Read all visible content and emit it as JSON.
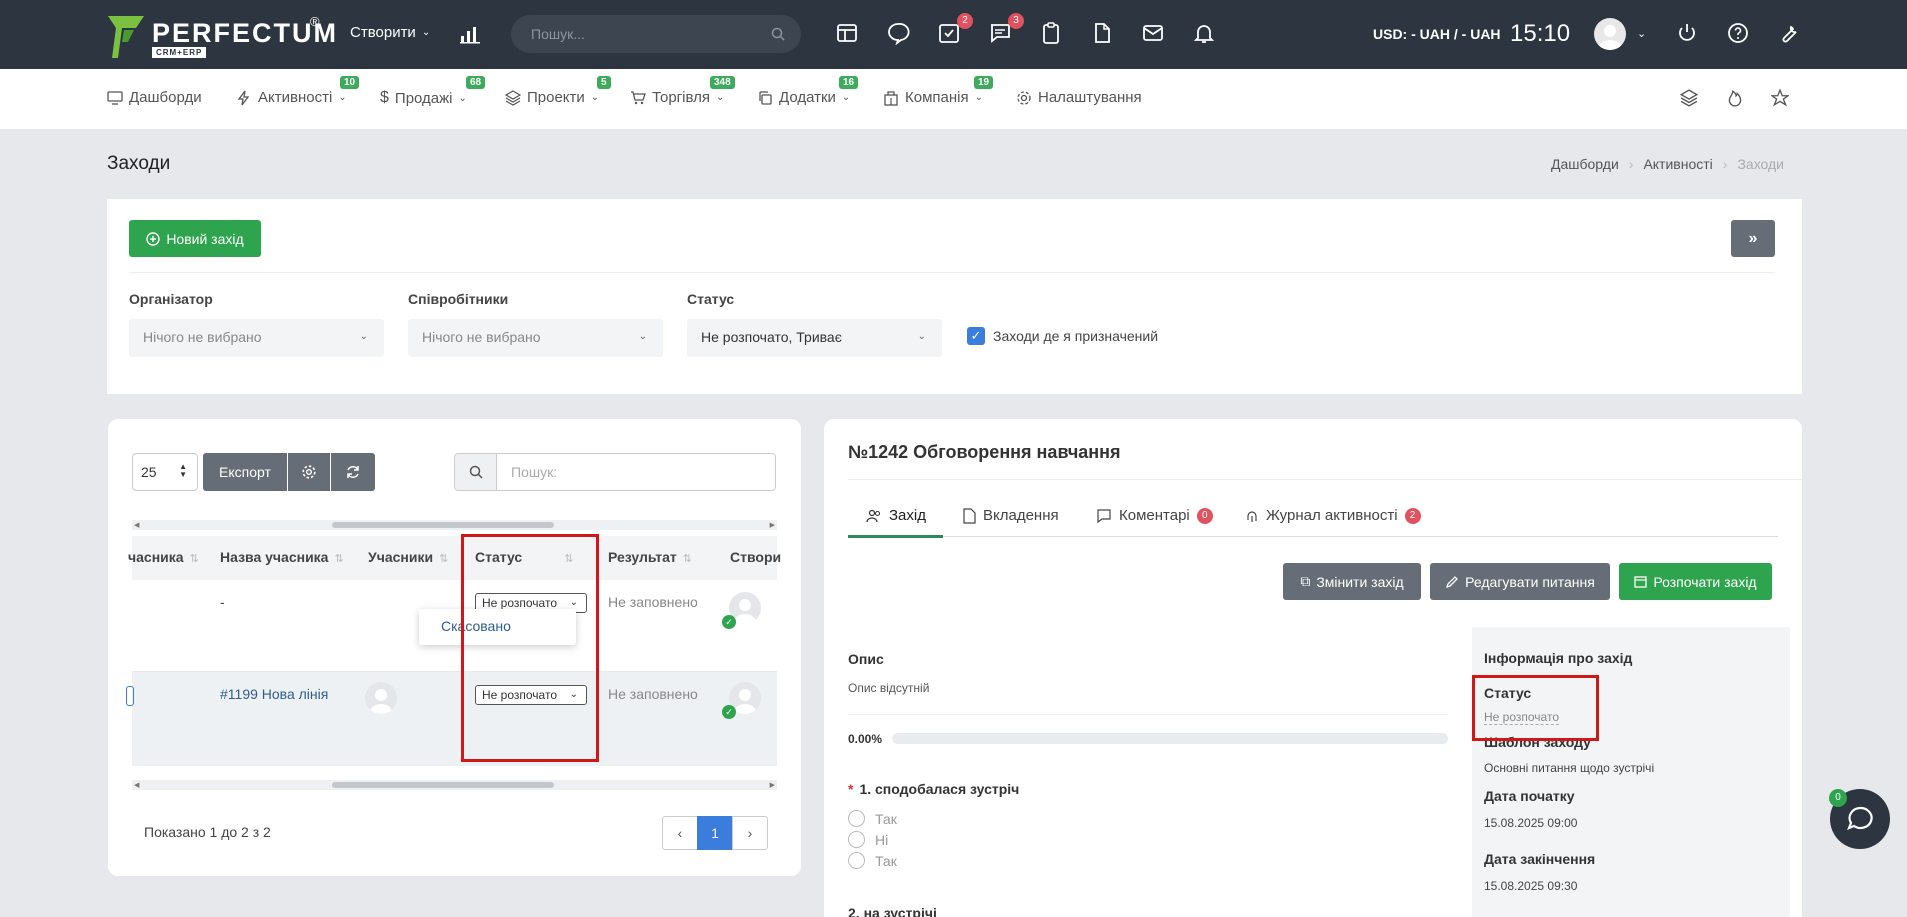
{
  "topbar": {
    "logo": {
      "name": "PERFECTUM",
      "sub": "CRM+ERP",
      "reg": "®"
    },
    "create_label": "Створити",
    "search_placeholder": "Пошук...",
    "tasks_badge": "2",
    "chat_badge": "3",
    "currency": "USD: - UAH / - UAH",
    "time": "15:10"
  },
  "nav": {
    "items": [
      {
        "label": "Дашборди",
        "badge": ""
      },
      {
        "label": "Активності",
        "badge": "10"
      },
      {
        "label": "Продажі",
        "badge": "68"
      },
      {
        "label": "Проекти",
        "badge": "5"
      },
      {
        "label": "Торгівля",
        "badge": "348"
      },
      {
        "label": "Додатки",
        "badge": "16"
      },
      {
        "label": "Компанія",
        "badge": "19"
      },
      {
        "label": "Налаштування",
        "badge": ""
      }
    ]
  },
  "page": {
    "title": "Заходи",
    "breadcrumb": [
      "Дашборди",
      "Активності",
      "Заходи"
    ]
  },
  "filters": {
    "new_button": "Новий захід",
    "expand_button": "»",
    "organizer": {
      "label": "Організатор",
      "value": "Нічого не вибрано"
    },
    "employees": {
      "label": "Співробітники",
      "value": "Нічого не вибрано"
    },
    "status": {
      "label": "Статус",
      "value": "Не розпочато, Триває"
    },
    "assigned": {
      "label": "Заходи де я призначений",
      "checked": true
    }
  },
  "list": {
    "page_size": "25",
    "export_label": "Експорт",
    "search_placeholder": "Пошук:",
    "columns": [
      "часника",
      "Назва учасника",
      "Учасники",
      "Статус",
      "Результат",
      "Створи"
    ],
    "rows": [
      {
        "participant_name": "-",
        "status": "Не розпочато",
        "result": "Не заповнено"
      },
      {
        "participant_name": "#1199 Нова лінія",
        "status": "Не розпочато",
        "result": "Не заповнено"
      }
    ],
    "dropdown_option": "Скасовано",
    "shown_info": "Показано 1 до 2 з 2",
    "pagination": {
      "prev": "‹",
      "current": "1",
      "next": "›"
    }
  },
  "detail": {
    "title": "№1242 Обговорення навчання",
    "tabs": [
      {
        "label": "Захід",
        "badge": ""
      },
      {
        "label": "Вкладення",
        "badge": ""
      },
      {
        "label": "Коментарі",
        "badge": "0"
      },
      {
        "label": "Журнал активності",
        "badge": "2"
      }
    ],
    "actions": {
      "change": "Змінити захід",
      "edit_questions": "Редагувати питання",
      "start": "Розпочати захід"
    },
    "description_label": "Опис",
    "description_value": "Опис відсутній",
    "progress": "0.00%",
    "questions": [
      {
        "title": "1. сподобалася зустріч",
        "options": [
          "Так",
          "Ні",
          "Так"
        ]
      },
      {
        "title": "2. на зустрічі"
      }
    ],
    "info": {
      "title": "Інформація про захід",
      "status_label": "Статус",
      "status_value": "Не розпочато",
      "template_label": "Шаблон заходу",
      "template_value": "Основні питання щодо зустрічі",
      "start_label": "Дата початку",
      "start_value": "15.08.2025 09:00",
      "end_label": "Дата закінчення",
      "end_value": "15.08.2025 09:30"
    }
  },
  "chat": {
    "badge": "0"
  },
  "colors": {
    "topbar": "#2d3540",
    "primary_green": "#2ea44f",
    "accent_blue": "#3b7ddd",
    "highlight_red": "#d01818"
  }
}
